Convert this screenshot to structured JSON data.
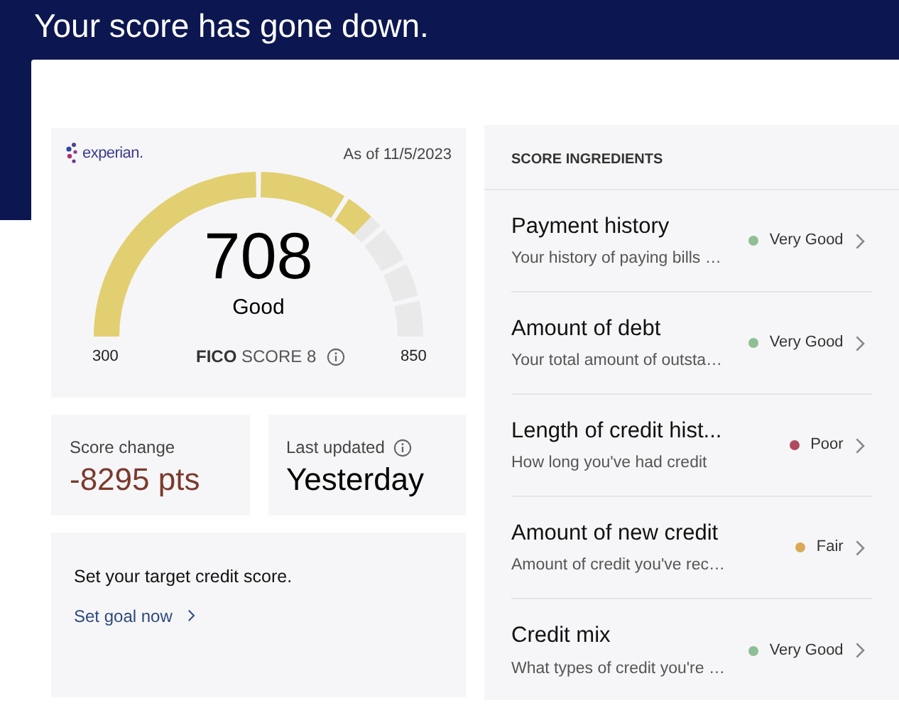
{
  "page_title": "Your score has gone down.",
  "score_card": {
    "logo_text": "experian.",
    "as_of": "As of 11/5/2023",
    "score": "708",
    "rating": "Good",
    "min": "300",
    "max": "850",
    "model_brand": "FICO",
    "model_name": "SCORE 8"
  },
  "stats": [
    {
      "label": "Score change",
      "value": "-8295 pts",
      "kind": "change"
    },
    {
      "label": "Last updated",
      "value": "Yesterday",
      "kind": "info"
    }
  ],
  "goal": {
    "text": "Set your target credit score.",
    "link": "Set goal now"
  },
  "ingredients": {
    "heading": "SCORE INGREDIENTS",
    "items": [
      {
        "title": "Payment history",
        "subtitle": "Your history of paying bills …",
        "rating": "Very Good",
        "color": "#8fbf94"
      },
      {
        "title": "Amount of debt",
        "subtitle": "Your total amount of outsta…",
        "rating": "Very Good",
        "color": "#8fbf94"
      },
      {
        "title": "Length of credit hist...",
        "subtitle": "How long you've had credit",
        "rating": "Poor",
        "color": "#b04a5e"
      },
      {
        "title": "Amount of new credit",
        "subtitle": "Amount of credit you've rec…",
        "rating": "Fair",
        "color": "#d9aa55"
      },
      {
        "title": "Credit mix",
        "subtitle": "What types of credit you're …",
        "rating": "Very Good",
        "color": "#8fbf94"
      }
    ]
  }
}
